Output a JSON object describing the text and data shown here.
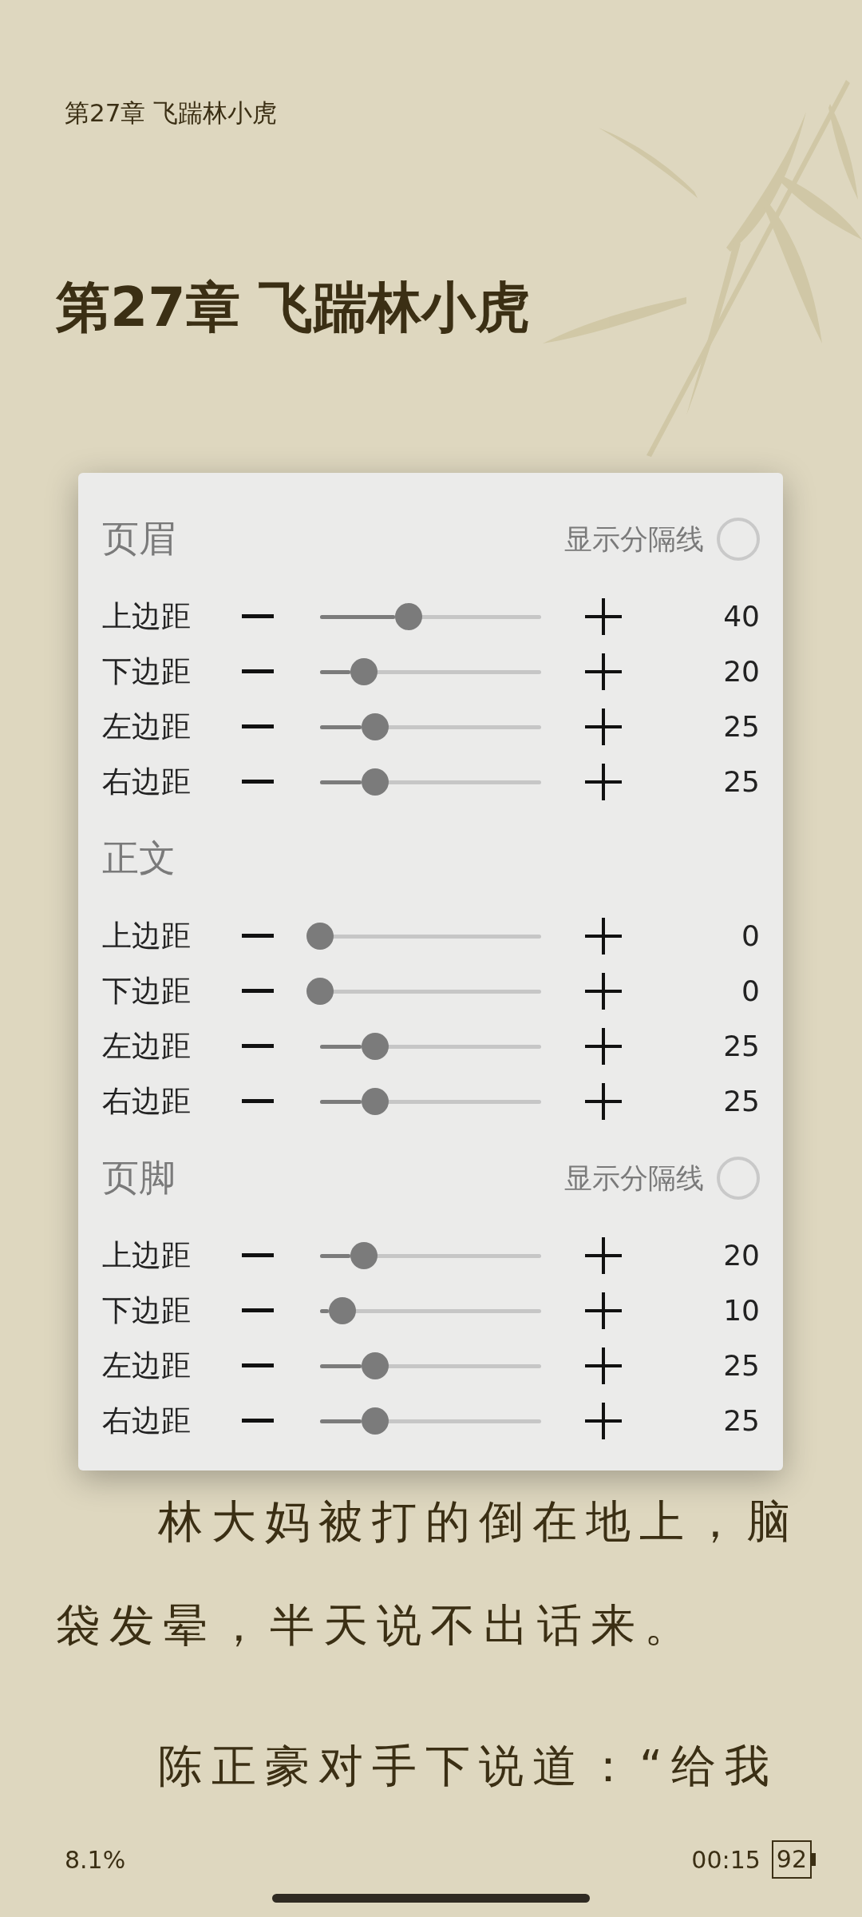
{
  "running_header": "第27章 飞踹林小虎",
  "chapter_title": "第27章 飞踹林小虎",
  "margin_dialog": {
    "sections": [
      {
        "title": "页眉",
        "divider_toggle": {
          "label": "显示分隔线",
          "on": false
        },
        "rows": [
          {
            "label": "上边距",
            "level": 0.4,
            "value": "40"
          },
          {
            "label": "下边距",
            "level": 0.2,
            "value": "20"
          },
          {
            "label": "左边距",
            "level": 0.25,
            "value": "25"
          },
          {
            "label": "右边距",
            "level": 0.25,
            "value": "25"
          }
        ]
      },
      {
        "title": "正文",
        "rows": [
          {
            "label": "上边距",
            "level": 0,
            "value": "0"
          },
          {
            "label": "下边距",
            "level": 0,
            "value": "0"
          },
          {
            "label": "左边距",
            "level": 0.25,
            "value": "25"
          },
          {
            "label": "右边距",
            "level": 0.25,
            "value": "25"
          }
        ]
      },
      {
        "title": "页脚",
        "divider_toggle": {
          "label": "显示分隔线",
          "on": false
        },
        "rows": [
          {
            "label": "上边距",
            "level": 0.2,
            "value": "20"
          },
          {
            "label": "下边距",
            "level": 0.1,
            "value": "10"
          },
          {
            "label": "左边距",
            "level": 0.25,
            "value": "25"
          },
          {
            "label": "右边距",
            "level": 0.25,
            "value": "25"
          }
        ]
      }
    ]
  },
  "paragraphs": [
    {
      "lines": [
        "林大妈被打的倒在地上，脑",
        "袋发晕，半天说不出话来。"
      ]
    },
    {
      "lines": [
        "陈正豪对手下说道：“给我"
      ]
    }
  ],
  "footer": {
    "progress": "8.1%",
    "time": "00:15",
    "battery": "92"
  }
}
